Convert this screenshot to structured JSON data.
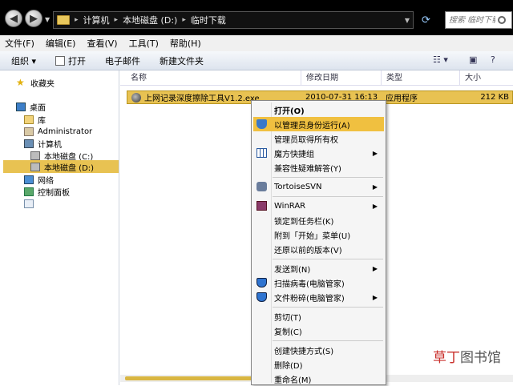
{
  "address": {
    "crumbs": [
      "计算机",
      "本地磁盘 (D:)",
      "临时下载"
    ]
  },
  "search": {
    "placeholder": "搜索 临时下载"
  },
  "menubar": [
    "文件(F)",
    "编辑(E)",
    "查看(V)",
    "工具(T)",
    "帮助(H)"
  ],
  "toolbar": {
    "organize": "组织 ▾",
    "open": "打开",
    "email": "电子邮件",
    "new_folder": "新建文件夹"
  },
  "sidebar": {
    "favorites": "收藏夹",
    "desktop": "桌面",
    "library": "库",
    "user": "Administrator",
    "computer": "计算机",
    "drive_c": "本地磁盘 (C:)",
    "drive_d": "本地磁盘 (D:)",
    "network": "网络",
    "control_panel": "控制面板"
  },
  "columns": {
    "name": "名称",
    "modified": "修改日期",
    "type": "类型",
    "size": "大小"
  },
  "file": {
    "name": "上网记录深度擦除工具V1.2.exe",
    "modified": "2010-07-31 16:13",
    "type": "应用程序",
    "size": "212 KB"
  },
  "context_menu": {
    "open": "打开(O)",
    "run_as_admin": "以管理员身份运行(A)",
    "take_ownership": "管理员取得所有权",
    "magic_shortcuts": "魔方快捷组",
    "compat_troubleshoot": "兼容性疑难解答(Y)",
    "tortoisesvn": "TortoiseSVN",
    "winrar": "WinRAR",
    "pin_taskbar": "锁定到任务栏(K)",
    "pin_start": "附到「开始」菜单(U)",
    "restore_prev": "还原以前的版本(V)",
    "send_to": "发送到(N)",
    "scan_virus": "扫描病毒(电脑管家)",
    "file_shred": "文件粉碎(电脑管家)",
    "cut": "剪切(T)",
    "copy": "复制(C)",
    "create_shortcut": "创建快捷方式(S)",
    "delete": "删除(D)",
    "rename": "重命名(M)"
  },
  "watermark": {
    "red": "草丁",
    "gray": "图书馆"
  }
}
